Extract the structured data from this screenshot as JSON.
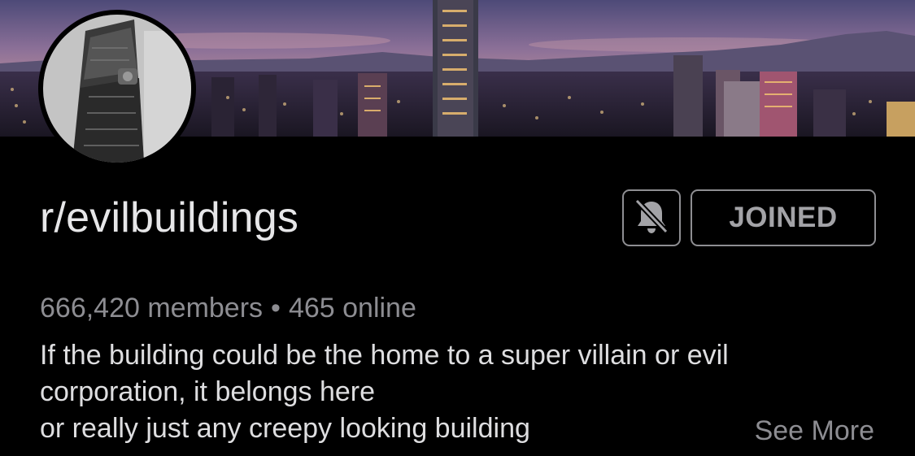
{
  "banner": {
    "image": "taipei-city-skyline-at-dusk"
  },
  "avatar": {
    "image": "grayscale-skyscraper-photo"
  },
  "community": {
    "name": "r/evilbuildings",
    "members": "666,420 members",
    "separator": "•",
    "online": "465 online",
    "description_lines": [
      "If the building could be the home to a super villain or evil",
      "corporation, it belongs here",
      "or really just any creepy looking building"
    ],
    "see_more_label": "See More"
  },
  "actions": {
    "notification_icon": "bell-off-icon",
    "joined_label": "JOINED"
  },
  "colors": {
    "background": "#000000",
    "border": "#8e8e92",
    "muted_text": "#8d8d92",
    "primary_text": "#e6e6e8"
  }
}
